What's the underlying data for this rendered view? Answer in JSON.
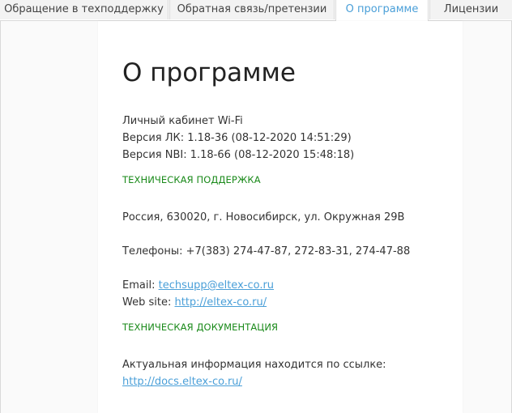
{
  "tabs": [
    {
      "label": "Обращение в техподдержку"
    },
    {
      "label": "Обратная связь/претензии"
    },
    {
      "label": "О программе"
    },
    {
      "label": "Лицензии"
    }
  ],
  "active_tab": "О программе",
  "about": {
    "title": "О программе",
    "product_name": "Личный кабинет Wi-Fi",
    "version_lk": "Версия ЛК: 1.18-36 (08-12-2020 14:51:29)",
    "version_nbi": "Версия NBI: 1.18-66 (08-12-2020 15:48:18)"
  },
  "support": {
    "heading": "ТЕХНИЧЕСКАЯ ПОДДЕРЖКА",
    "address": "Россия, 630020, г. Новосибирск, ул. Окружная 29В",
    "phones": "Телефоны: +7(383) 274-47-87, 272-83-31, 274-47-88",
    "email_label": "Email:",
    "email": "techsupp@eltex-co.ru",
    "website_label": "Web site:",
    "website": "http://eltex-co.ru/"
  },
  "docs": {
    "heading": "ТЕХНИЧЕСКАЯ ДОКУМЕНТАЦИЯ",
    "info_text": "Актуальная информация находится по ссылке:",
    "link": "http://docs.eltex-co.ru/"
  },
  "colors": {
    "link": "#4a9fd8",
    "section_heading": "#1a8a1a",
    "active_tab_text": "#4a9fd8"
  }
}
